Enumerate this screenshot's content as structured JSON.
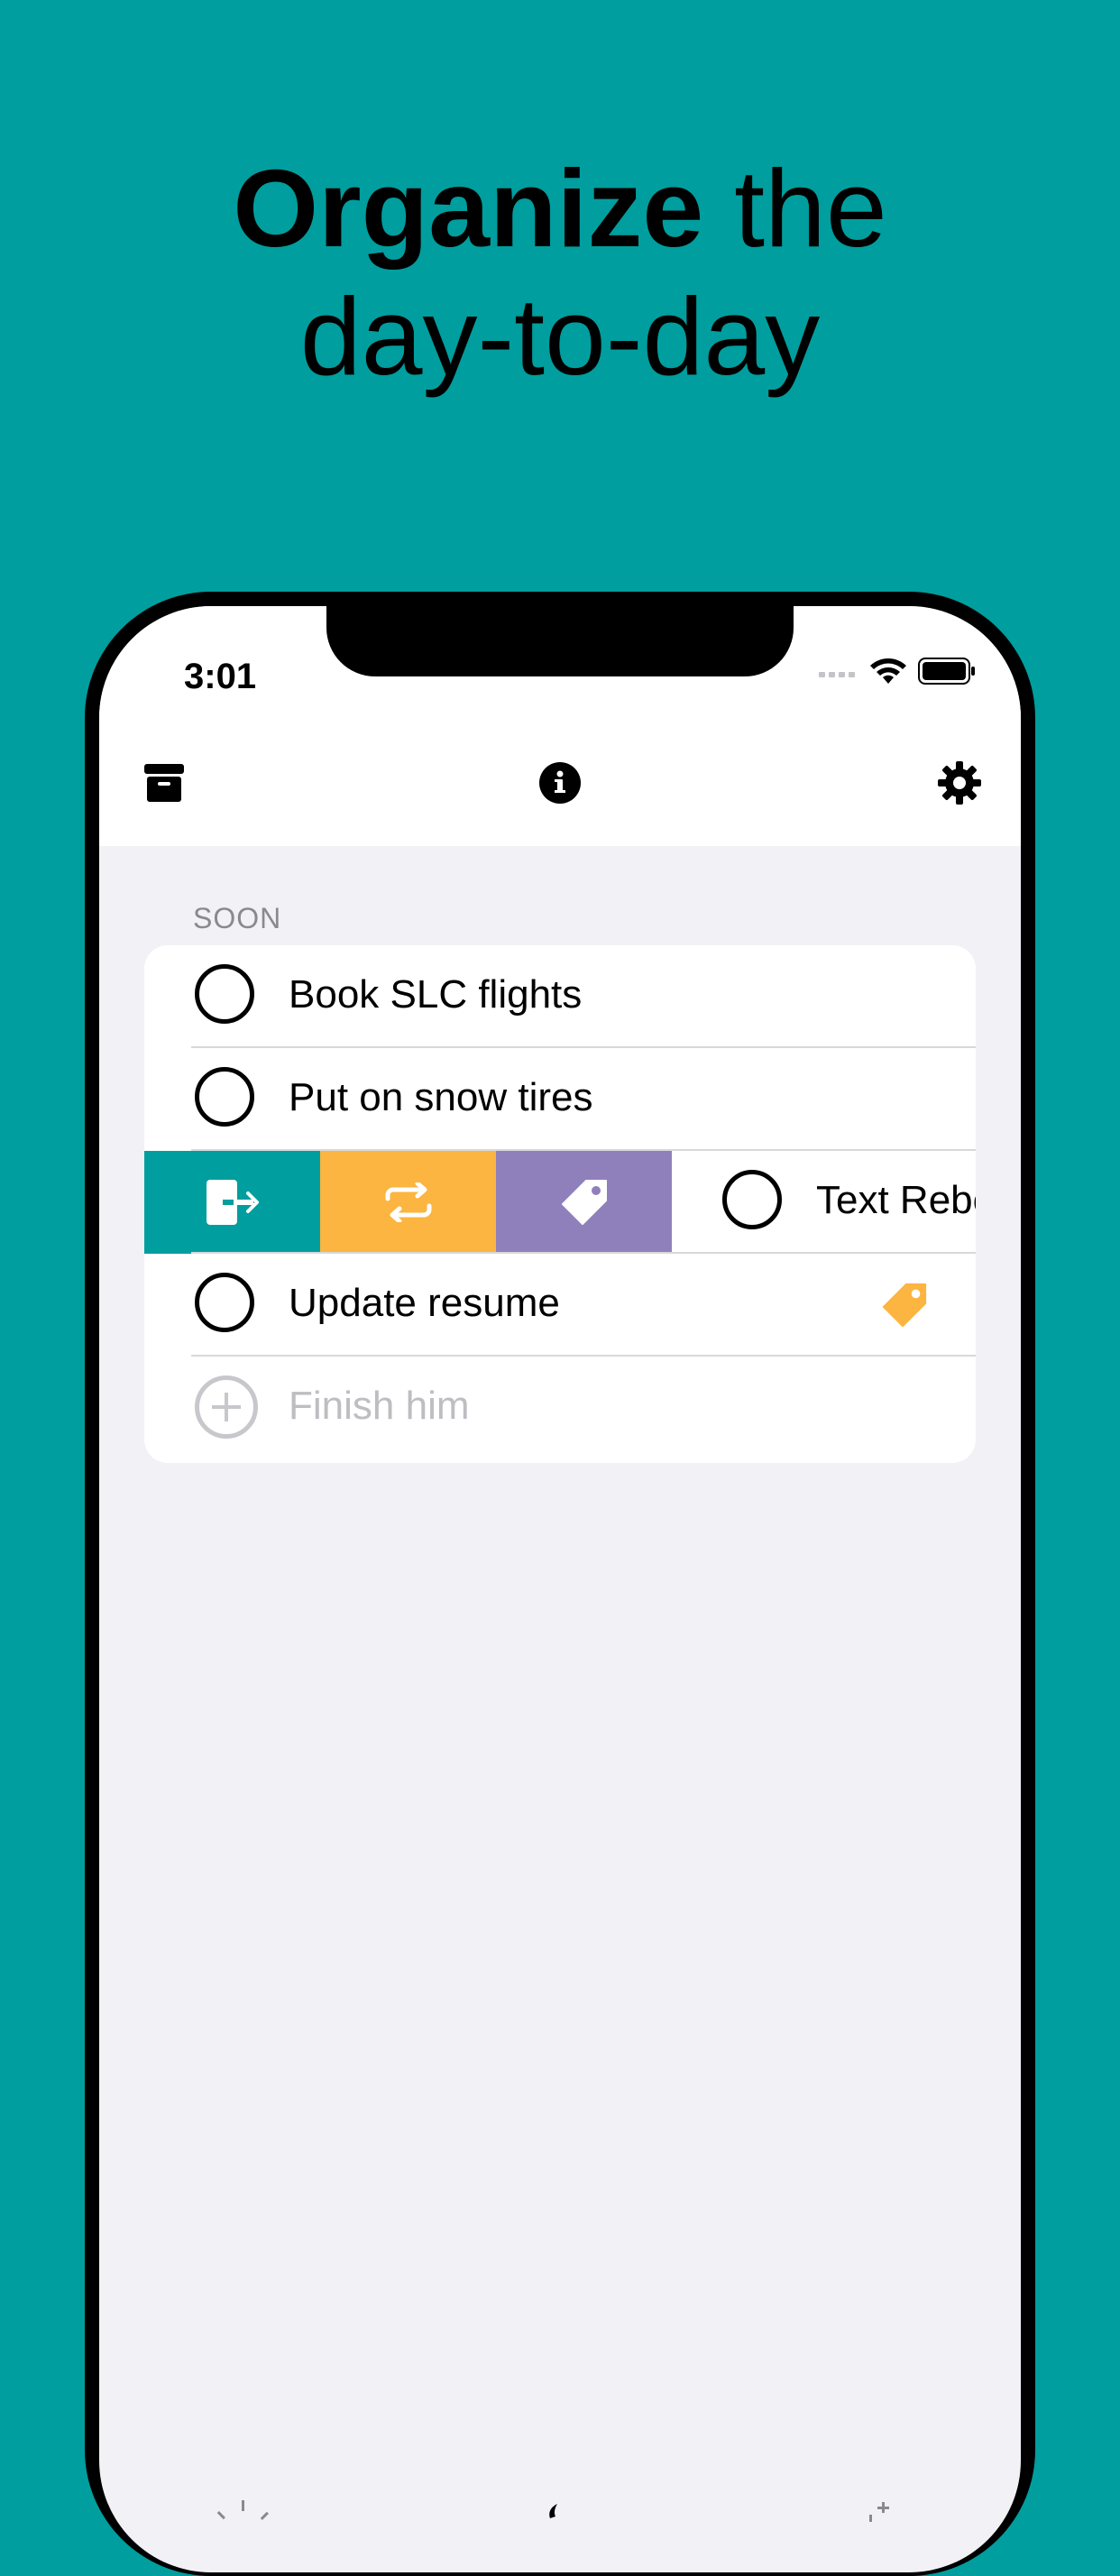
{
  "headline": {
    "bold": "Organize",
    "rest": " the",
    "line2": "day-to-day"
  },
  "status_bar": {
    "time": "3:01",
    "icons": [
      "signal-icon",
      "wifi-icon",
      "battery-icon"
    ]
  },
  "nav": {
    "left_icon": "archive-icon",
    "center_icon": "info-icon",
    "right_icon": "gear-icon"
  },
  "section": {
    "title": "SOON"
  },
  "tasks": [
    {
      "label": "Book SLC flights"
    },
    {
      "label": "Put on snow tires"
    },
    {
      "label": "Text Rebe",
      "swiped": true
    },
    {
      "label": "Update resume",
      "tag_color": "#fbb540"
    }
  ],
  "swipe_actions": [
    {
      "name": "move-icon",
      "color": "#009e9e"
    },
    {
      "name": "repeat-icon",
      "color": "#fbb540"
    },
    {
      "name": "tag-icon",
      "color": "#8f80bb"
    }
  ],
  "add_task": {
    "placeholder": "Finish him"
  },
  "colors": {
    "background": "#009e9e",
    "accent_yellow": "#fbb540",
    "accent_purple": "#8f80bb",
    "list_background": "#f1f1f6"
  }
}
